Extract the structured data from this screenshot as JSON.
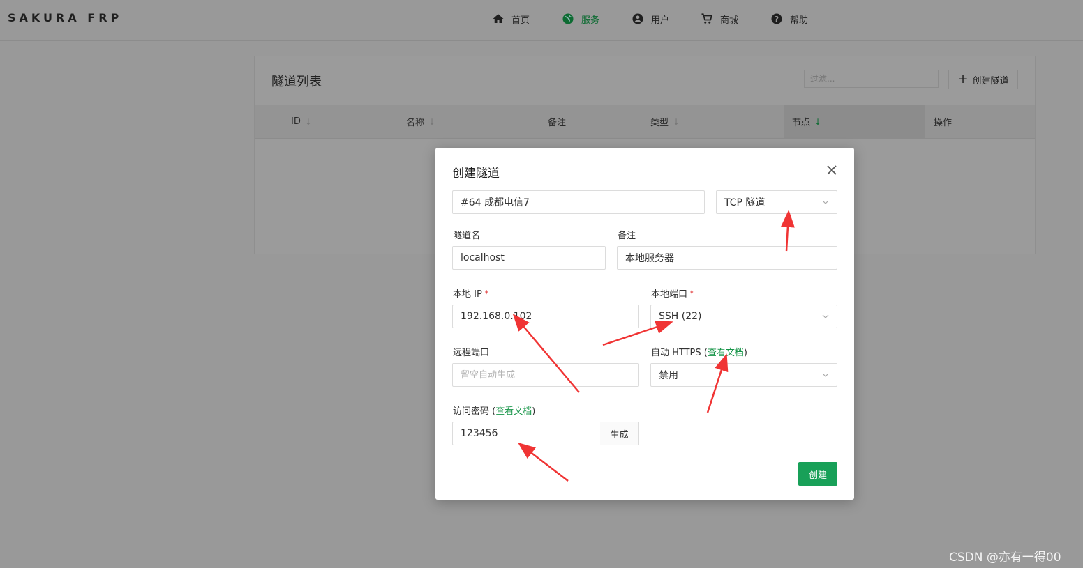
{
  "header": {
    "brand": "SAKURA FRP",
    "nav": [
      {
        "label": "首页",
        "icon": "home-icon"
      },
      {
        "label": "服务",
        "icon": "globe-icon",
        "active": true
      },
      {
        "label": "用户",
        "icon": "user-icon"
      },
      {
        "label": "商城",
        "icon": "cart-icon"
      },
      {
        "label": "帮助",
        "icon": "help-icon"
      }
    ]
  },
  "panel": {
    "title": "隧道列表",
    "filter_placeholder": "过滤...",
    "create_label": "创建隧道",
    "columns": [
      "ID",
      "名称",
      "备注",
      "类型",
      "节点",
      "操作"
    ],
    "sort_arrow": "↓"
  },
  "modal": {
    "title": "创建隧道",
    "node_value": "#64 成都电信7",
    "type_value": "TCP 隧道",
    "name_label": "隧道名",
    "name_value": "localhost",
    "note_label": "备注",
    "note_value": "本地服务器",
    "local_ip_label": "本地 IP",
    "local_ip_value": "192.168.0.102",
    "local_port_label": "本地端口",
    "local_port_value": "SSH (22)",
    "required_mark": "*",
    "remote_port_label": "远程端口",
    "remote_port_placeholder": "留空自动生成",
    "auto_https_label": "自动 HTTPS",
    "auto_https_value": "禁用",
    "doc_link": "查看文档",
    "paren_open": "(",
    "paren_close": ")",
    "password_label": "访问密码",
    "password_value": "123456",
    "generate_label": "生成",
    "submit_label": "创建"
  },
  "watermark": "CSDN @亦有一得00",
  "colors": {
    "accent": "#18a058",
    "link": "#159447",
    "required": "#e23b3b",
    "annotation_arrow": "#f03434",
    "overlay": "#999999"
  }
}
